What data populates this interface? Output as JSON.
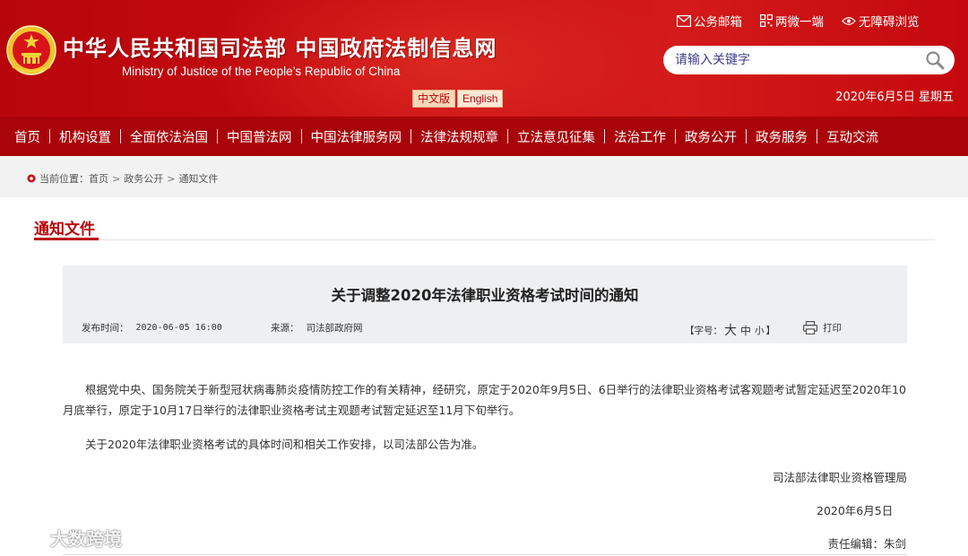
{
  "header": {
    "title": "中华人民共和国司法部  中国政府法制信息网",
    "subtitle": "Ministry of Justice of the People’s Republic of China",
    "lang_cn": "中文版",
    "lang_en": "English",
    "links": [
      "公务邮箱",
      "两微一端",
      "无障碍浏览"
    ],
    "search_placeholder": "请输入关键字",
    "date": "2020年6月5日  星期五"
  },
  "nav": {
    "items": [
      "首页",
      "机构设置",
      "全面依法治国",
      "中国普法网",
      "中国法律服务网",
      "法律法规规章",
      "立法意见征集",
      "法治工作",
      "政务公开",
      "政务服务",
      "互动交流"
    ]
  },
  "breadcrumb": {
    "prefix": "当前位置：",
    "items": [
      "首页",
      "政务公开",
      "通知文件"
    ]
  },
  "section": {
    "title": "通知文件"
  },
  "article": {
    "title": "关于调整2020年法律职业资格考试时间的通知",
    "date_label": "发布时间：",
    "date_value": "2020-06-05 16:00",
    "source_label": "来源：",
    "source_value": "司法部政府网",
    "font_label_open": "【字号：",
    "font_big": "大",
    "font_mid": "中",
    "font_small": "小",
    "font_label_close": "】",
    "print_label": "打印",
    "paragraphs": [
      "根据党中央、国务院关于新型冠状病毒肺炎疫情防控工作的有关精神，经研究，原定于2020年9月5日、6日举行的法律职业资格考试客观题考试暂定延迟至2020年10月底举行，原定于10月17日举行的法律职业资格考试主观题考试暂定延迟至11月下旬举行。",
      "关于2020年法律职业资格考试的具体时间和相关工作安排，以司法部公告为准。"
    ],
    "signature": "司法部法律职业资格管理局",
    "signature_date": "2020年6月5日",
    "editor": "责任编辑：朱剑"
  },
  "watermark": "大数跨境",
  "colors": {
    "brand_red": "#b8050b",
    "nav_red": "#a9040a"
  }
}
